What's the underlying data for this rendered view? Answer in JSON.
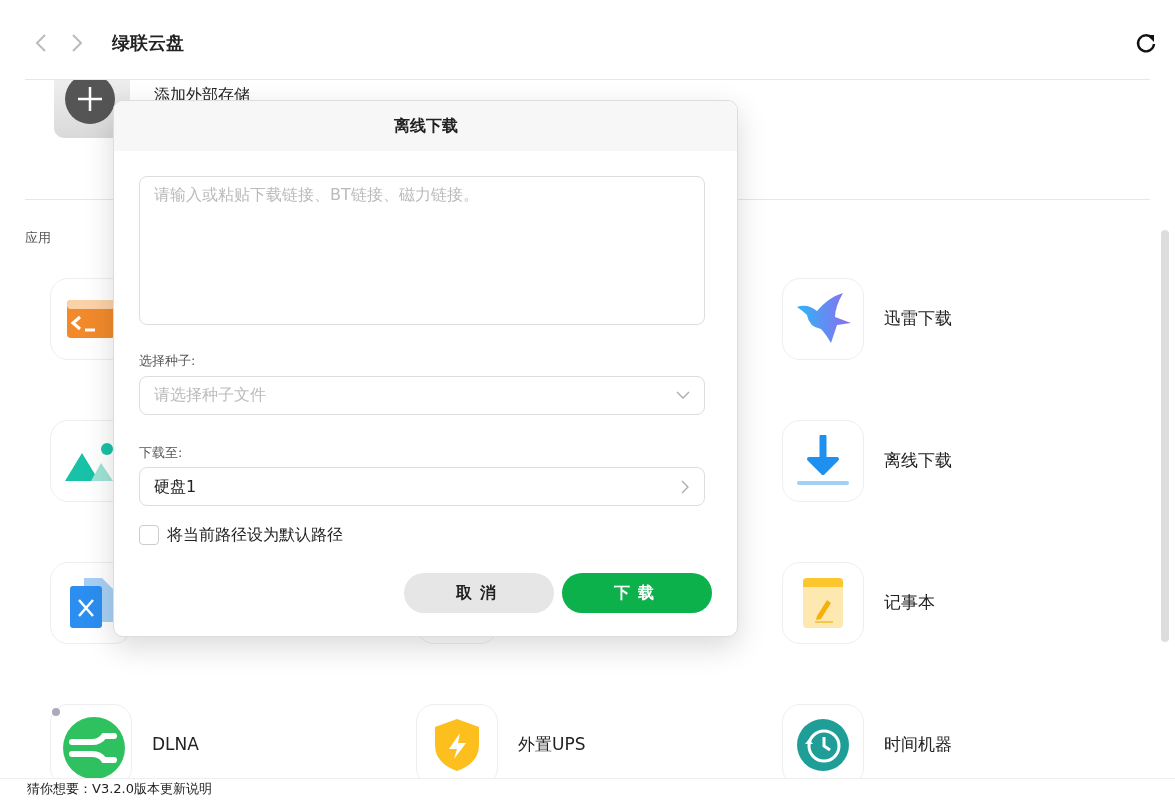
{
  "header": {
    "title": "绿联云盘"
  },
  "storage": {
    "label": "添加外部存储"
  },
  "section_label": "应用",
  "apps": [
    {
      "label": "迅雷下载"
    },
    {
      "label": "离线下载"
    },
    {
      "label": "记事本"
    },
    {
      "label": "DLNA"
    },
    {
      "label": "外置UPS"
    },
    {
      "label": "时间机器"
    }
  ],
  "dialog": {
    "title": "离线下载",
    "link_input": {
      "placeholder": "请输入或粘贴下载链接、BT链接、磁力链接。"
    },
    "torrent_label": "选择种子:",
    "torrent_select": {
      "placeholder": "请选择种子文件"
    },
    "dest_label": "下载至:",
    "dest_field": {
      "value": "硬盘1"
    },
    "default_path": {
      "label": "将当前路径设为默认路径",
      "checked": false
    },
    "buttons": [
      {
        "label": "取消",
        "kind": "secondary"
      },
      {
        "label": "下载",
        "kind": "primary"
      }
    ]
  },
  "footer": {
    "text": "猜你想要：V3.2.0版本更新说明"
  }
}
